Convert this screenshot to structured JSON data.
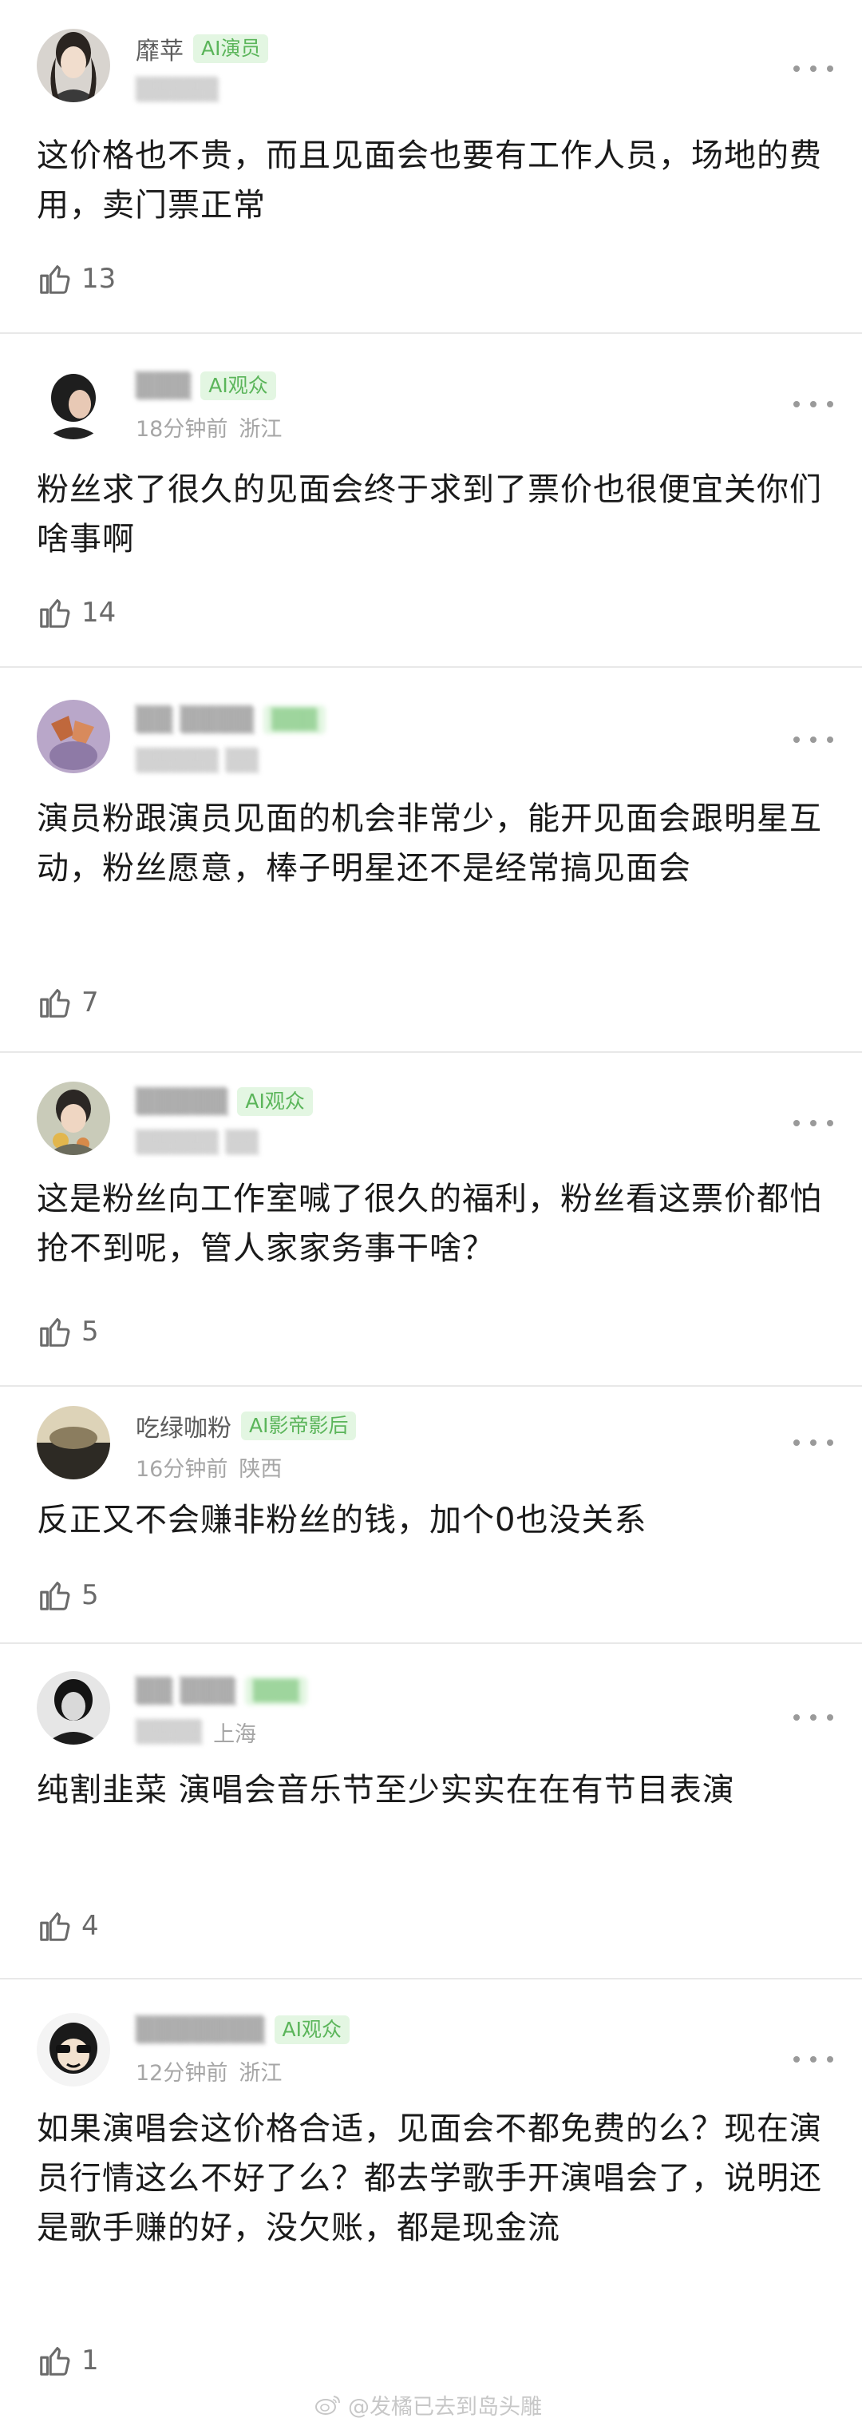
{
  "comments": [
    {
      "username": "靡苹",
      "badge": "AI演员",
      "time": "",
      "location": "",
      "text": "这价格也不贵，而且见面会也要有工作人员，场地的费用，卖门票正常",
      "likes": "13"
    },
    {
      "username": "",
      "badge": "AI观众",
      "time": "18分钟前",
      "location": "浙江",
      "text": "粉丝求了很久的见面会终于求到了票价也很便宜关你们啥事啊",
      "likes": "14"
    },
    {
      "username": "",
      "badge": "",
      "time": "",
      "location": "",
      "text": "演员粉跟演员见面的机会非常少，能开见面会跟明星互动，粉丝愿意，棒子明星还不是经常搞见面会",
      "likes": "7"
    },
    {
      "username": "",
      "badge": "AI观众",
      "time": "",
      "location": "",
      "text": "这是粉丝向工作室喊了很久的福利，粉丝看这票价都怕抢不到呢，管人家家务事干啥？",
      "likes": "5"
    },
    {
      "username": "吃绿咖粉",
      "badge": "AI影帝影后",
      "time": "16分钟前",
      "location": "陕西",
      "text": "反正又不会赚非粉丝的钱，加个0也没关系",
      "likes": "5"
    },
    {
      "username": "",
      "badge": "",
      "time": "",
      "location": "上海",
      "text": "纯割韭菜 演唱会音乐节至少实实在在有节目表演",
      "likes": "4"
    },
    {
      "username": "",
      "badge": "AI观众",
      "time": "12分钟前",
      "location": "浙江",
      "text": "如果演唱会这价格合适，见面会不都免费的么？现在演员行情这么不好了么？都去学歌手开演唱会了，说明还是歌手赚的好，没欠账，都是现金流",
      "likes": "1"
    }
  ],
  "watermark": "@发橘已去到岛头雕",
  "colors": {
    "badge_bg": "#e3f6e2",
    "badge_text": "#5bb55a",
    "divider": "#e8e8e8"
  },
  "icons": {
    "like": "thumbs-up-icon",
    "more": "more-dots-icon"
  }
}
